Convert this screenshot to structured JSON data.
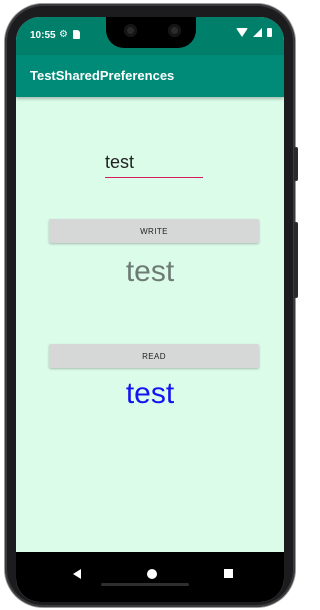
{
  "status_bar": {
    "time": "10:55",
    "icons": [
      "gear-icon",
      "sd-card-icon",
      "wifi-icon",
      "cellular-icon",
      "battery-icon"
    ],
    "color": "#007f6b"
  },
  "app_bar": {
    "title": "TestSharedPreferences",
    "color": "#008b78"
  },
  "main": {
    "input_value": "test",
    "write_button_label": "WRITE",
    "written_text": "test",
    "read_button_label": "READ",
    "read_text": "test",
    "background": "#dcfcea",
    "read_text_color": "#1414f0",
    "input_underline_color": "#d81b60"
  },
  "nav_bar": {
    "icons": [
      "back-icon",
      "home-icon",
      "recents-icon"
    ]
  }
}
